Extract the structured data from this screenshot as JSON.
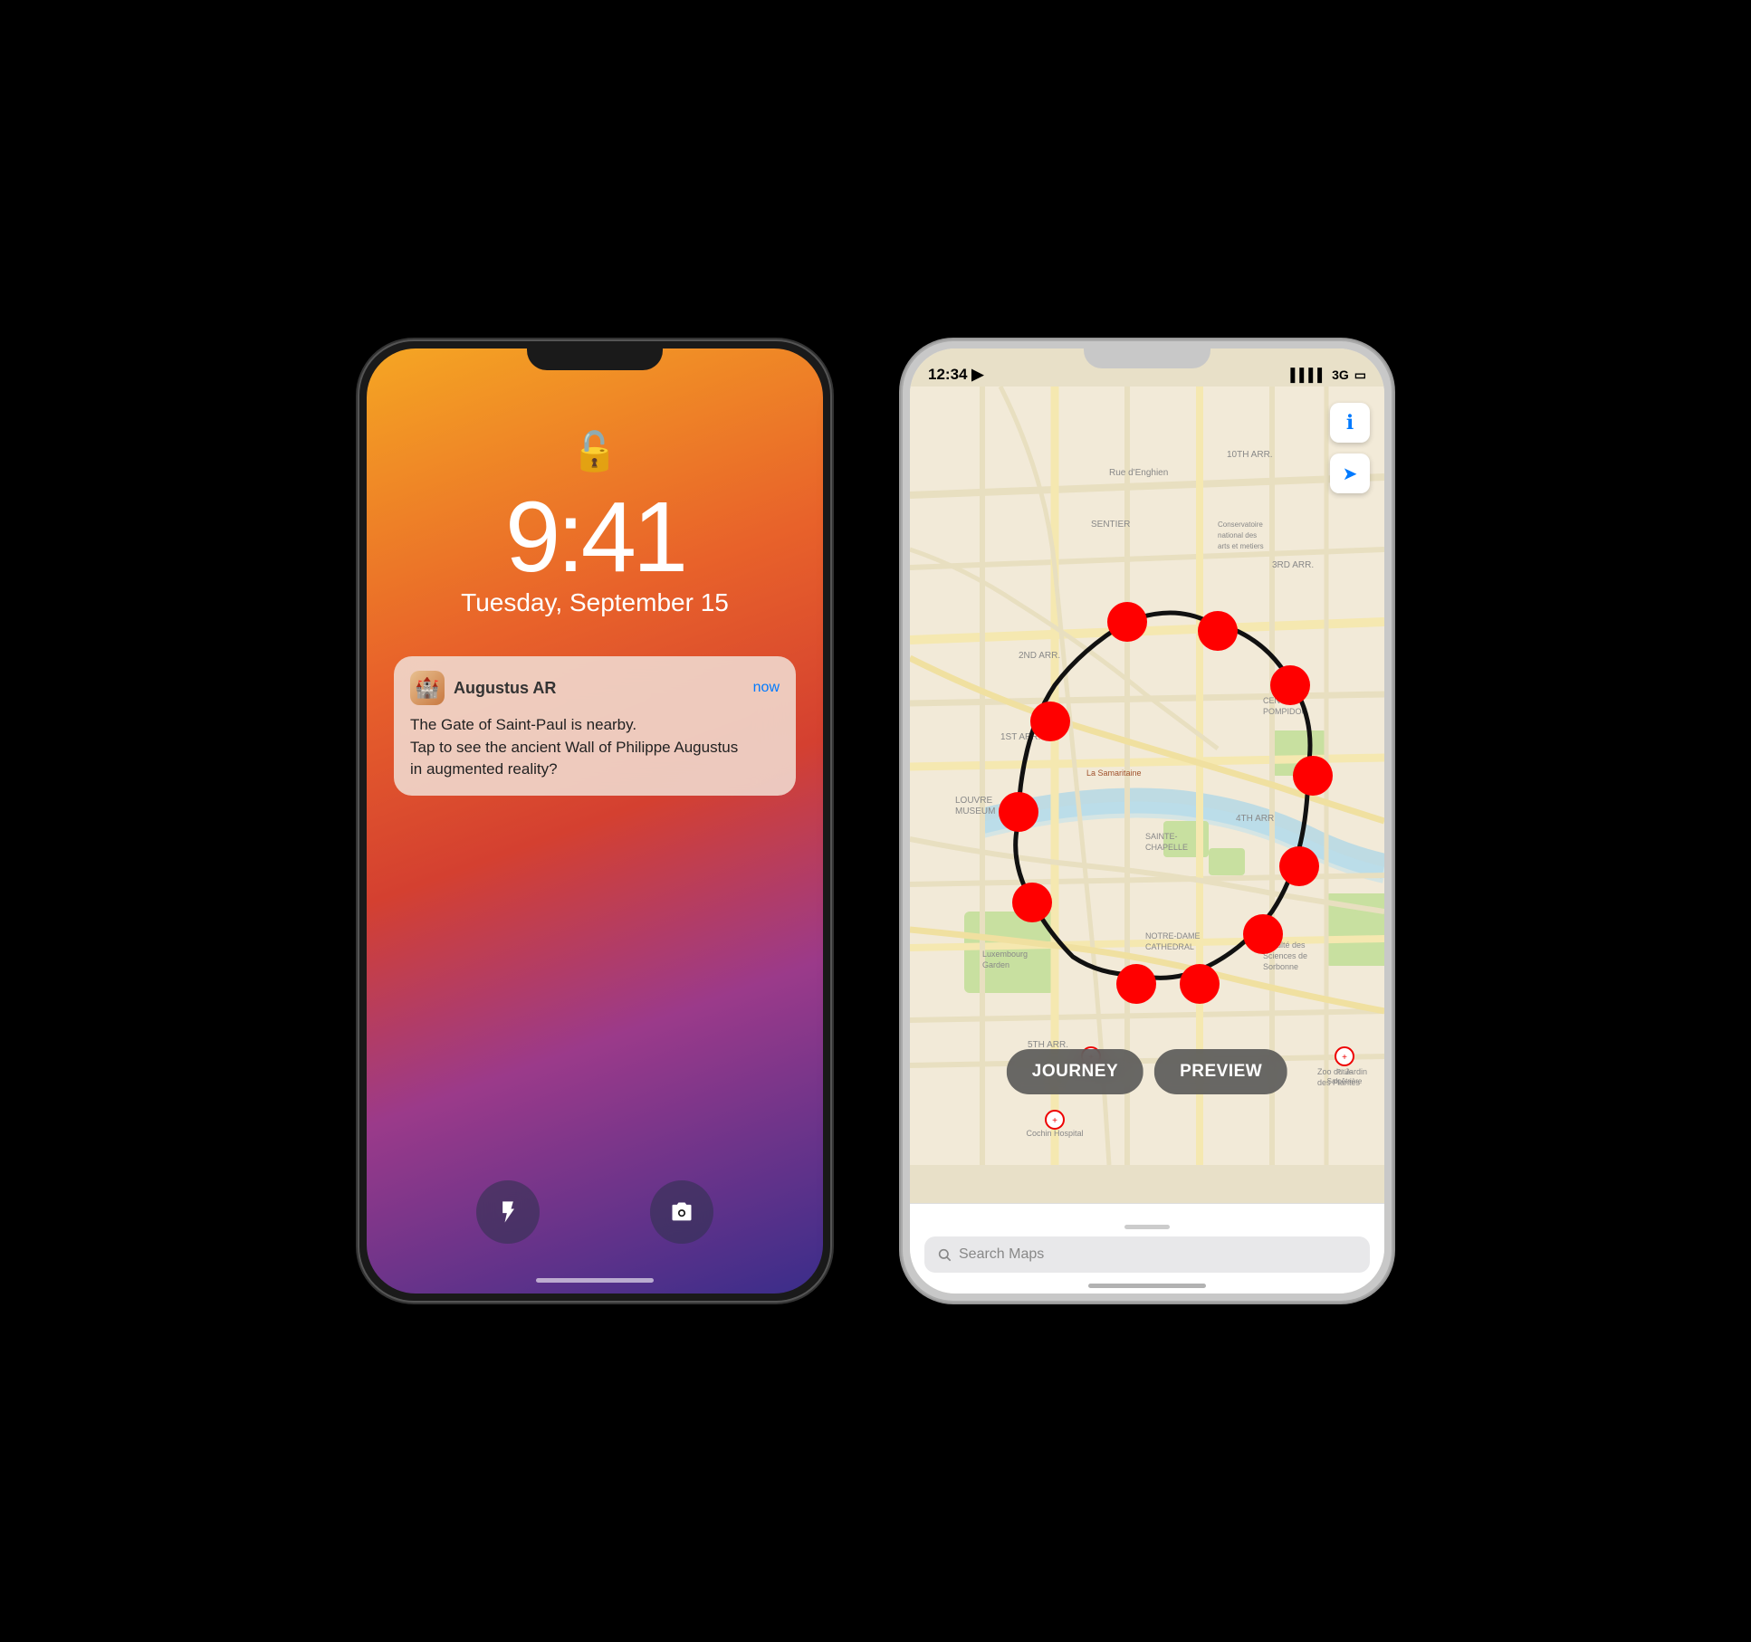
{
  "left_phone": {
    "time": "9:41",
    "date": "Tuesday, September 15",
    "notification": {
      "app_name": "Augustus AR",
      "time_label": "now",
      "body_line1": "The Gate of Saint-Paul is nearby.",
      "body_line2": "Tap to see the ancient Wall of Philippe Augustus",
      "body_line3": "in augmented reality?"
    },
    "btn_flashlight": "🔦",
    "btn_camera": "📷"
  },
  "right_phone": {
    "status_time": "12:34 ▶",
    "status_signal": "▌▌▌▌",
    "status_network": "3G",
    "status_battery": "🔋",
    "map_labels": {
      "arr_10th": "10TH ARR.",
      "arr_3rd": "3RD ARR.",
      "arr_2nd": "2ND ARR.",
      "arr_1st": "1ST ARR.",
      "arr_4th": "4TH ARR",
      "arr_5th": "5TH ARR.",
      "sentier": "SENTIER",
      "louvre_museum": "LOUVRE\nMUSEUM",
      "centre_pompidou": "CENTRE\nPOMPIDOU",
      "sainte_chapelle": "SAINTE-\nCHAPELLE",
      "notre_dame": "NOTRE-DAME\nCATHEDRAL",
      "la_samaritaine": "La Samaritaine",
      "conservatoire": "Conservatoire\nnational des\narts et metiers"
    },
    "buttons": {
      "journey": "JOURNEY",
      "preview": "PREVIEW"
    },
    "search_placeholder": "Search Maps",
    "info_icon": "ℹ",
    "location_icon": "➤"
  }
}
